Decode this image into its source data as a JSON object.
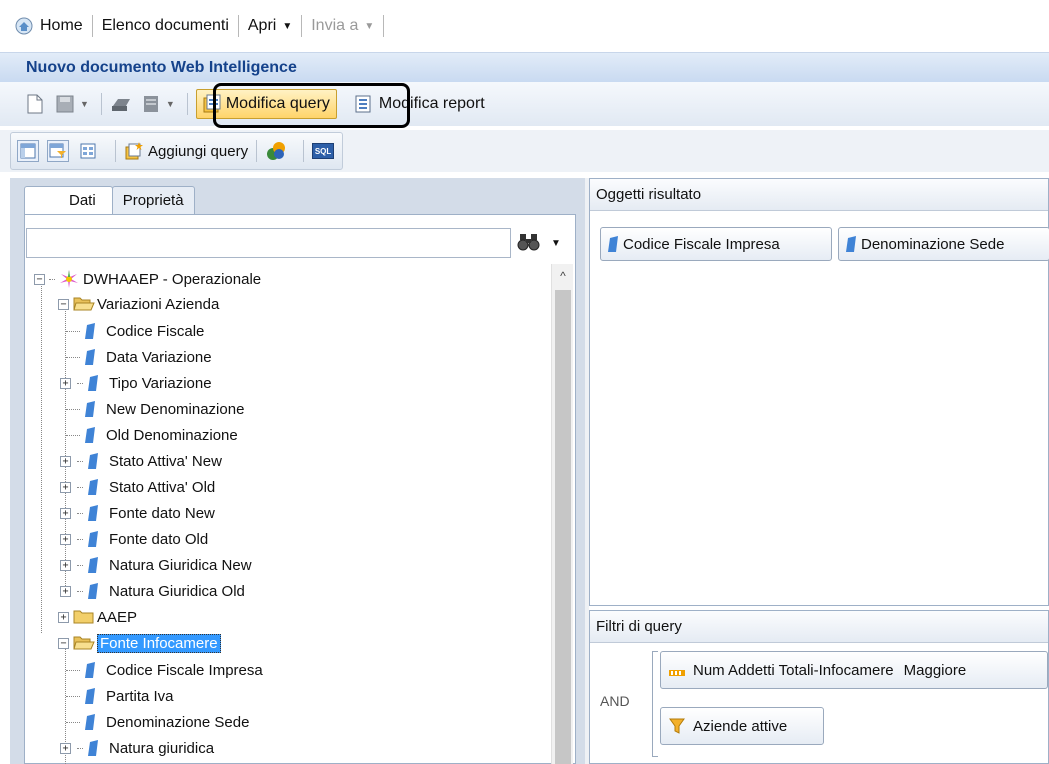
{
  "nav": {
    "home": "Home",
    "documents": "Elenco documenti",
    "open": "Apri",
    "send": "Invia a"
  },
  "document_title": "Nuovo documento Web Intelligence",
  "toolbar1": {
    "edit_query": "Modifica query",
    "edit_report": "Modifica report"
  },
  "toolbar2": {
    "add_query": "Aggiungi query",
    "sql": "SQL"
  },
  "tabs": [
    "Dati",
    "Proprietà"
  ],
  "search": {
    "value": "",
    "placeholder": ""
  },
  "tree": {
    "root": "DWHAAEP - Operazionale",
    "folder1": {
      "label": "Variazioni Azienda",
      "items": [
        "Codice Fiscale",
        "Data Variazione",
        "Tipo Variazione",
        "New Denominazione",
        "Old Denominazione",
        "Stato Attiva' New",
        "Stato Attiva' Old",
        "Fonte dato New",
        "Fonte dato Old",
        "Natura Giuridica New",
        "Natura Giuridica Old"
      ]
    },
    "folder2": {
      "label": "AAEP"
    },
    "folder3": {
      "label": "Fonte Infocamere",
      "items": [
        "Codice Fiscale Impresa",
        "Partita Iva",
        "Denominazione Sede",
        "Natura giuridica"
      ]
    }
  },
  "result_objects": {
    "title": "Oggetti risultato",
    "items": [
      "Codice Fiscale Impresa",
      "Denominazione Sede"
    ]
  },
  "query_filters": {
    "title": "Filtri di query",
    "operator": "AND",
    "filter1": "Num Addetti Totali-Infocamere",
    "filter1_op": "Maggiore",
    "filter2": "Aziende attive"
  },
  "colors": {
    "title_text": "#15428b",
    "highlight_button": "#ffd46a",
    "dimension_icon": "#3f83d6",
    "selection": "#3399ff"
  }
}
